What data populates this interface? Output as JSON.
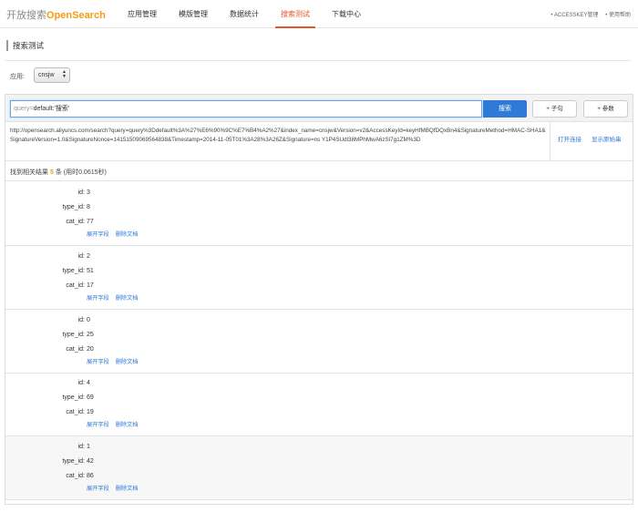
{
  "header": {
    "logo_prefix": "开放搜索",
    "logo_brand": "OpenSearch",
    "nav": [
      {
        "label": "应用管理",
        "active": false
      },
      {
        "label": "模版管理",
        "active": false
      },
      {
        "label": "数据统计",
        "active": false
      },
      {
        "label": "搜索测试",
        "active": true
      },
      {
        "label": "下载中心",
        "active": false
      }
    ],
    "right_links": [
      "• ACCESSKEY管理",
      "• 使用帮助"
    ]
  },
  "page": {
    "title": "搜索测试",
    "app_label": "应用:",
    "app_selected": "cnsjw"
  },
  "search": {
    "query_prefix": "query=",
    "query_value": "default:'搜索'",
    "search_button": "搜索",
    "add_clause_button": "+ 子句",
    "add_param_button": "+ 参数",
    "request_url": "http://opensearch.aliyuncs.com/search?query=query%3Ddefault%3A%27%E6%90%9C%E7%B4%A2%27&index_name=cnsjw&Version=v2&AccessKeyId=keyHfMBQfDQxBn4&SignatureMethod=HMAC-SHA1&SignatureVersion=1.0&SignatureNonce=14151509069564838&Timestamp=2014-11-05T01%3A28%3A26Z&Signature=ns Y1P4SUdl38MPhMwA6zSl7g1ZM%3D",
    "open_link": "打开连接",
    "show_original": "显示原始串"
  },
  "results": {
    "summary_prefix": "找到相关结果",
    "count": "5",
    "summary_unit": "条",
    "time_text": "(用时0.0615秒)",
    "labels": {
      "id": "id:",
      "type_id": "type_id:",
      "cat_id": "cat_id:"
    },
    "expand_label": "展开字段",
    "delete_label": "删除文档",
    "items": [
      {
        "id": "3",
        "type_id": "8",
        "cat_id": "77"
      },
      {
        "id": "2",
        "type_id": "51",
        "cat_id": "17"
      },
      {
        "id": "0",
        "type_id": "25",
        "cat_id": "20"
      },
      {
        "id": "4",
        "type_id": "69",
        "cat_id": "19"
      },
      {
        "id": "1",
        "type_id": "42",
        "cat_id": "86"
      }
    ]
  },
  "colors": {
    "accent": "#e8542e",
    "brand": "#f39c12",
    "link": "#2f7ad6",
    "primary_button": "#2f7ad6"
  }
}
